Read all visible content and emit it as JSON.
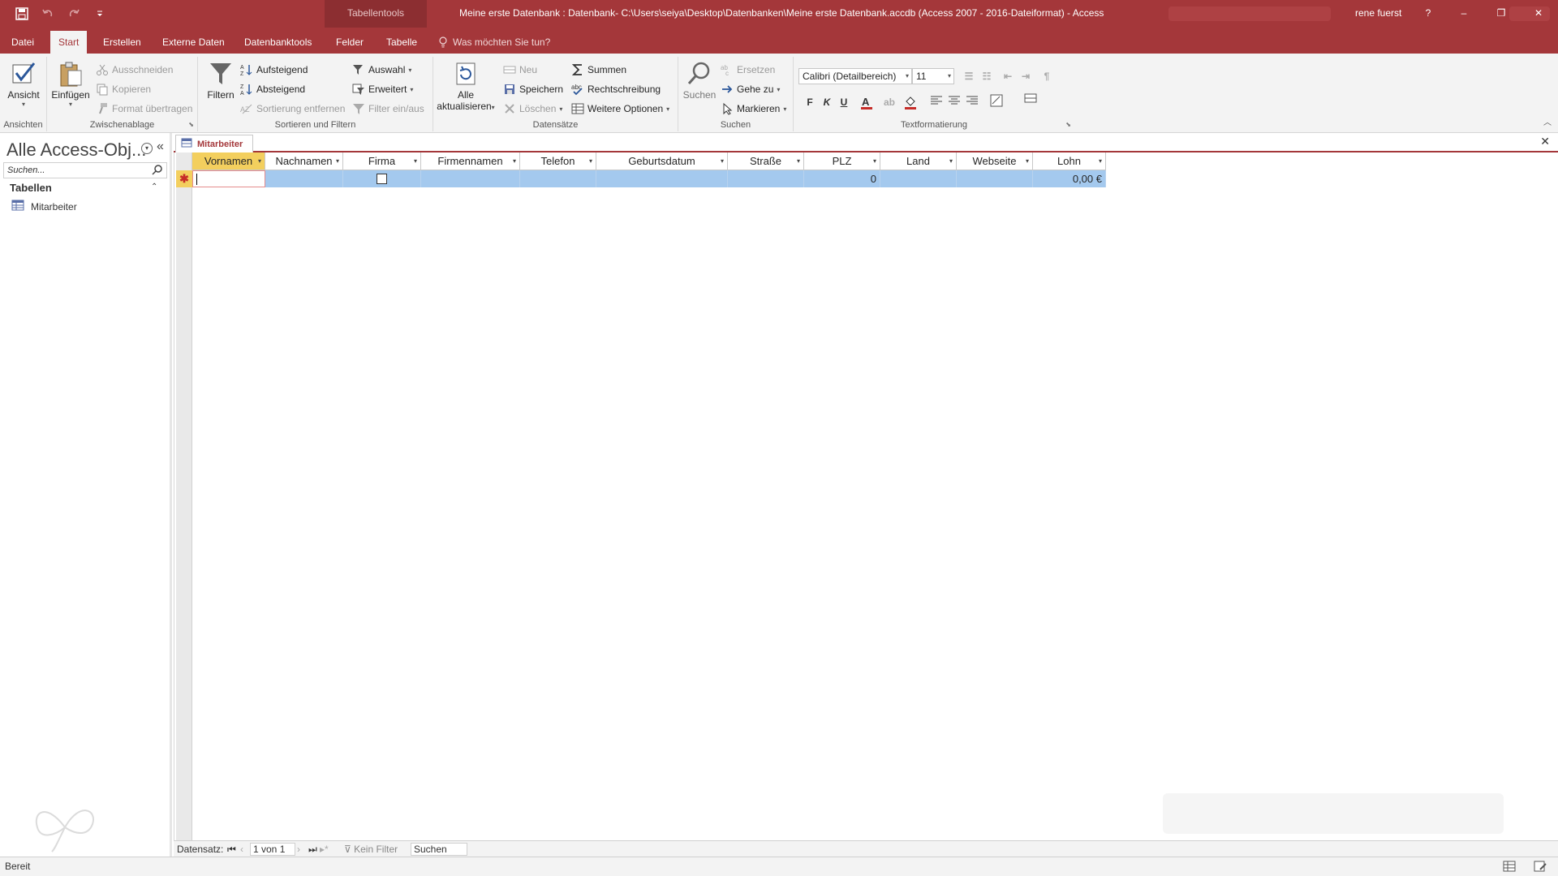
{
  "titlebar": {
    "context_tab": "Tabellentools",
    "title": "Meine erste Datenbank : Datenbank- C:\\Users\\seiya\\Desktop\\Datenbanken\\Meine erste Datenbank.accdb (Access 2007 - 2016-Dateiformat)  -  Access",
    "user": "rene fuerst",
    "help": "?",
    "minimize": "–",
    "restore": "❐",
    "close": "✕"
  },
  "tabs": [
    "Datei",
    "Start",
    "Erstellen",
    "Externe Daten",
    "Datenbanktools",
    "Felder",
    "Tabelle"
  ],
  "tell_me": "Was möchten Sie tun?",
  "ribbon": {
    "ansichten": {
      "label": "Ansichten",
      "ansicht": "Ansicht"
    },
    "zwischenablage": {
      "label": "Zwischenablage",
      "einfuegen": "Einfügen",
      "ausschneiden": "Ausschneiden",
      "kopieren": "Kopieren",
      "format": "Format übertragen"
    },
    "sortieren": {
      "label": "Sortieren und Filtern",
      "filtern": "Filtern",
      "aufsteigend": "Aufsteigend",
      "absteigend": "Absteigend",
      "sortierung": "Sortierung entfernen",
      "auswahl": "Auswahl",
      "erweitert": "Erweitert",
      "filter": "Filter ein/aus"
    },
    "datensaetze": {
      "label": "Datensätze",
      "alle": "Alle",
      "aktualisieren": "aktualisieren",
      "neu": "Neu",
      "speichern": "Speichern",
      "loeschen": "Löschen",
      "summen": "Summen",
      "rechtschreibung": "Rechtschreibung",
      "weitere": "Weitere Optionen"
    },
    "suchen": {
      "label": "Suchen",
      "suchen": "Suchen",
      "ersetzen": "Ersetzen",
      "gehe": "Gehe zu",
      "markieren": "Markieren"
    },
    "text": {
      "label": "Textformatierung",
      "font": "Calibri (Detailbereich)",
      "size": "11",
      "bold": "F",
      "italic": "K",
      "underline": "U",
      "accent": "#c62c28"
    }
  },
  "nav": {
    "title": "Alle Access-Obj...",
    "search_placeholder": "Suchen...",
    "section": "Tabellen",
    "items": [
      "Mitarbeiter"
    ]
  },
  "document": {
    "tab": "Mitarbeiter"
  },
  "table": {
    "columns": [
      "Vornamen",
      "Nachnamen",
      "Firma",
      "Firmennamen",
      "Telefon",
      "Geburtsdatum",
      "Straße",
      "PLZ",
      "Land",
      "Webseite",
      "Lohn"
    ],
    "new_row_marker": "✱",
    "new_row": {
      "plz": "0",
      "lohn": "0,00 €"
    }
  },
  "recnav": {
    "label": "Datensatz:",
    "position": "1 von 1",
    "filter": "Kein Filter",
    "search": "Suchen"
  },
  "status": {
    "text": "Bereit"
  },
  "colors": {
    "brand": "#a4373a",
    "header_highlight": "#f3cf5e",
    "row_selection": "#a4c9ee"
  }
}
